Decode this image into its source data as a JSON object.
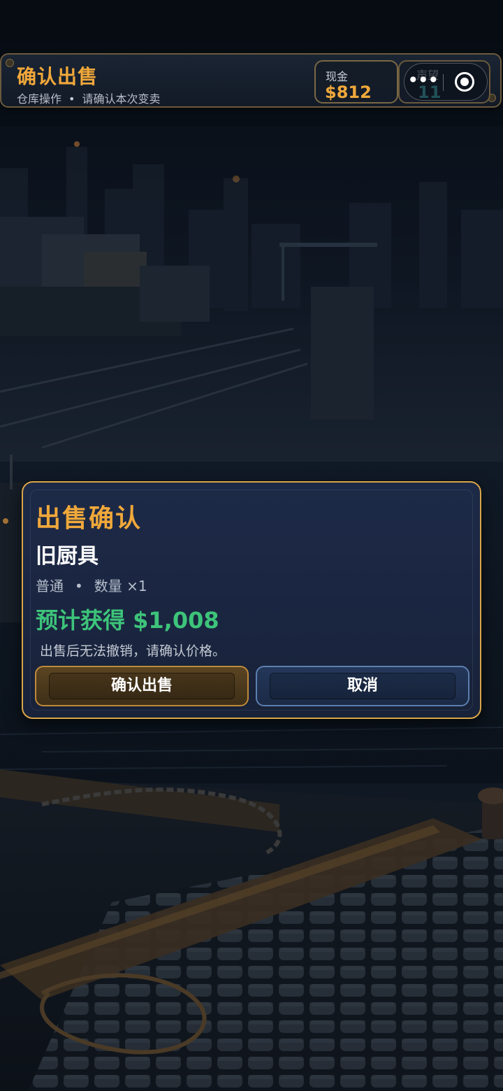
{
  "header": {
    "title": "确认出售",
    "subtitle_left": "仓库操作",
    "subtitle_dot": "•",
    "subtitle_right": "请确认本次变卖"
  },
  "stats": {
    "cash_label": "现金",
    "cash_value": "$812",
    "reputation_label": "声望",
    "reputation_value": "11"
  },
  "capsule": {
    "more_icon": "more-dots-icon",
    "close_icon": "target-circle-icon"
  },
  "dialog": {
    "title": "出售确认",
    "item_name": "旧厨具",
    "rarity": "普通",
    "meta_dot": "•",
    "quantity": "数量 ×1",
    "estimate": "预计获得 $1,008",
    "warning": "出售后无法撤销，请确认价格。",
    "confirm_label": "确认出售",
    "cancel_label": "取消"
  },
  "colors": {
    "accent_gold": "#f0a83a",
    "gain_green": "#3dc47a",
    "reputation_teal": "#3fa0a8",
    "dialog_border": "#d9a64a"
  }
}
